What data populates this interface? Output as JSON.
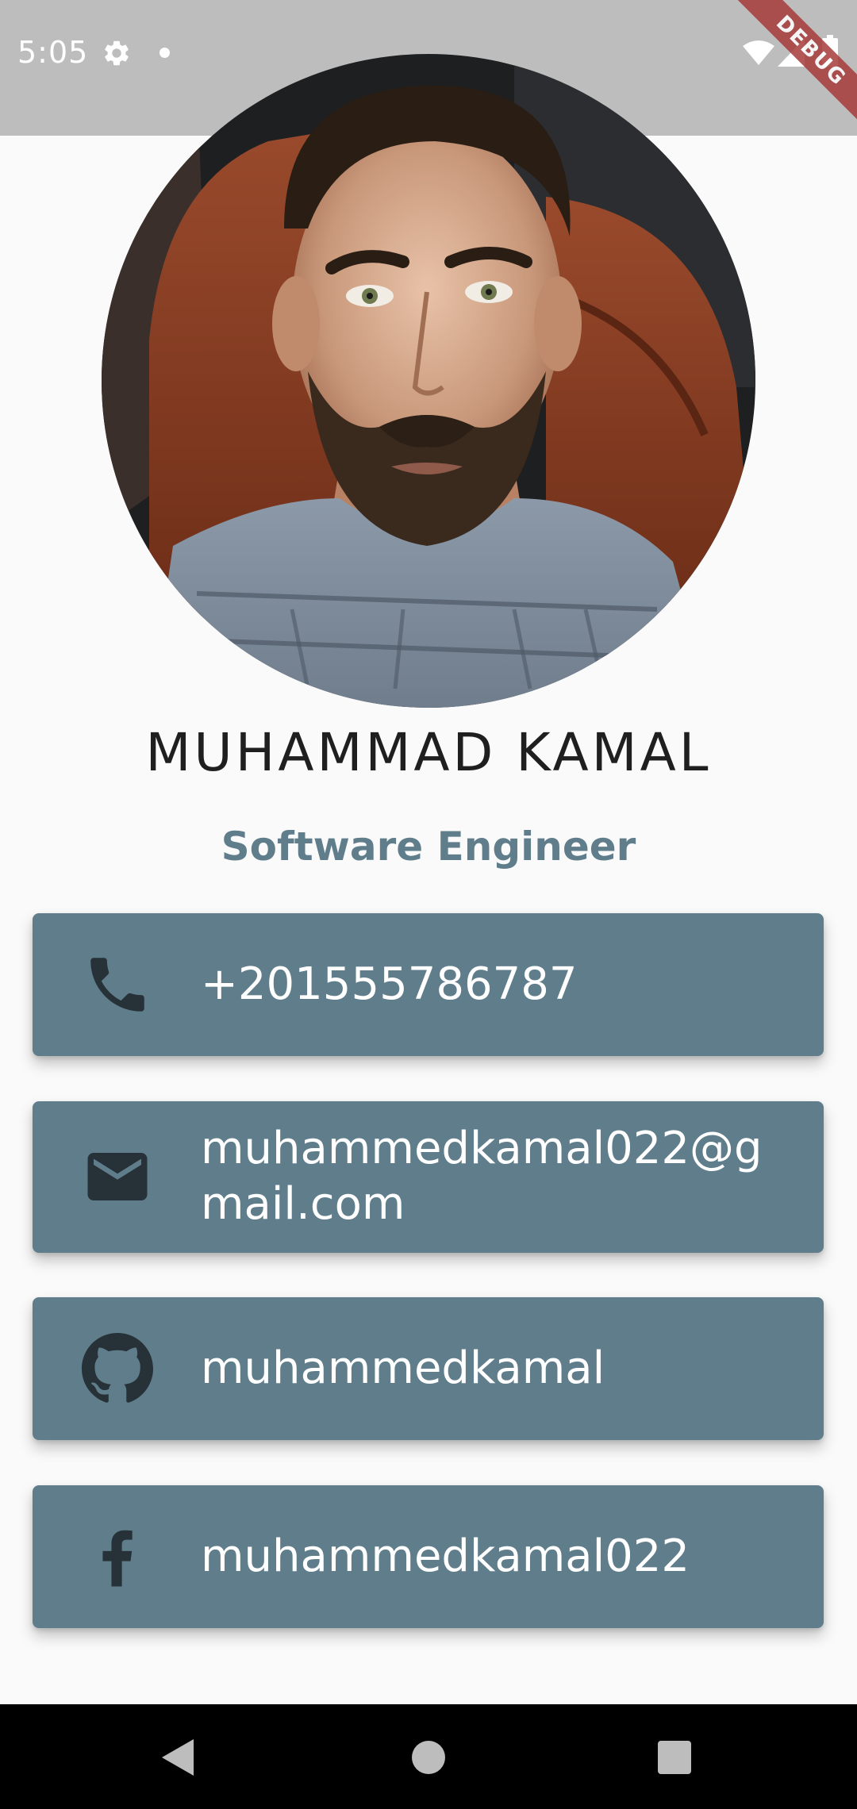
{
  "status_bar": {
    "time": "5:05",
    "icons": [
      "gear-icon",
      "notification-dot-icon",
      "wifi-icon",
      "signal-icon",
      "battery-icon"
    ],
    "background_color": "#bdbdbd"
  },
  "debug_banner": {
    "label": "DEBUG",
    "color": "#a63a3a"
  },
  "profile": {
    "name": "MUHAMMAD KAMAL",
    "title": "Software Engineer",
    "title_color": "#607d8b"
  },
  "contacts": [
    {
      "icon": "phone-icon",
      "value": "+201555786787"
    },
    {
      "icon": "mail-icon",
      "value": "muhammedkamal022@gmail.com"
    },
    {
      "icon": "github-icon",
      "value": "muhammedkamal"
    },
    {
      "icon": "facebook-icon",
      "value": "muhammedkamal022"
    }
  ],
  "card_color": "#607d8b",
  "navigation_bar": {
    "buttons": [
      "back-icon",
      "home-icon",
      "recents-icon"
    ]
  }
}
